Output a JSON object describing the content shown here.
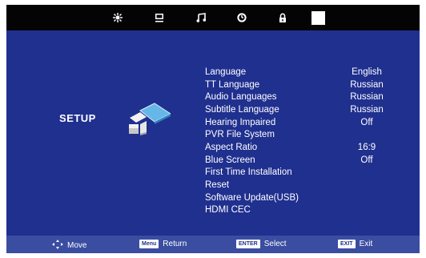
{
  "colors": {
    "panel": "#20308f",
    "topbar": "#040404",
    "bottombar": "#3a4da0",
    "text": "#ffffff"
  },
  "topbar": {
    "icons": [
      "picture-icon",
      "tv-channel-icon",
      "music-icon",
      "timer-icon",
      "lock-icon",
      "setup-tab-icon"
    ],
    "active_index": 5
  },
  "setup_title": "SETUP",
  "menu": [
    {
      "label": "Language",
      "value": "English"
    },
    {
      "label": "TT Language",
      "value": "Russian"
    },
    {
      "label": "Audio Languages",
      "value": "Russian"
    },
    {
      "label": "Subtitle Language",
      "value": "Russian"
    },
    {
      "label": "Hearing Impaired",
      "value": "Off"
    },
    {
      "label": "PVR File System",
      "value": ""
    },
    {
      "label": "Aspect Ratio",
      "value": "16:9"
    },
    {
      "label": "Blue Screen",
      "value": "Off"
    },
    {
      "label": "First Time Installation",
      "value": ""
    },
    {
      "label": "Reset",
      "value": ""
    },
    {
      "label": "Software Update(USB)",
      "value": ""
    },
    {
      "label": "HDMI CEC",
      "value": ""
    }
  ],
  "hints": {
    "move": "Move",
    "menu_key": "Menu",
    "return": "Return",
    "enter_key": "ENTER",
    "select": "Select",
    "exit_key": "EXIT",
    "exit": "Exit"
  }
}
